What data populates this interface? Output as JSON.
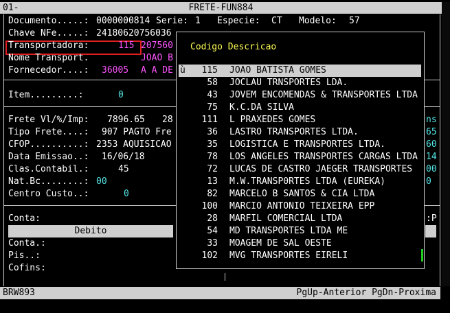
{
  "window": {
    "id": "01-",
    "title": "FRETE-FUN884"
  },
  "header": {
    "documento_label": "Documento.....:",
    "documento_value": "0000000814",
    "serie_label": "Serie:",
    "serie_value": "1",
    "especie_label": "Especie:",
    "especie_value": "CT",
    "modelo_label": "Modelo:",
    "modelo_value": "57"
  },
  "fields": {
    "chave_label": "Chave NFe.....:",
    "chave_value": "24180620756036",
    "transp_label": "Transportadora:",
    "transp_code": "115",
    "transp_extra": "207560",
    "nome_label": "Nome Transport.",
    "nome_value": "JOAO B",
    "fornec_label": "Fornecedor....:",
    "fornec_code": "36005",
    "fornec_name": "A A DE",
    "item_label": "Item.........:",
    "item_value": "0",
    "frete_label": "Frete Vl/%/Imp:",
    "frete_value": "7896.65",
    "frete_pct": "28",
    "tipo_label": "Tipo Frete....:",
    "tipo_value": "907 PAGTO Fre",
    "cfop_label": "CFOP..........:",
    "cfop_value": "2353 AQUISICAO",
    "data_label": "Data Emissao..:",
    "data_value": "16/06/18",
    "clas_label": "Clas.Contabil.:",
    "clas_value": "45",
    "nat_label": "Nat.Bc........:",
    "nat_value": "00",
    "centro_label": "Centro Custo..:",
    "centro_value": "0"
  },
  "right_fragments": [
    "ns",
    "65",
    "60",
    "14",
    "00",
    "0"
  ],
  "right_p": ":P",
  "conta_section": {
    "conta_label": "Conta:",
    "debito_label": "Debito",
    "conta2_label": "Conta.:",
    "pis_label": "Pis..:",
    "cofins_label": "Cofins:"
  },
  "lookup": {
    "header": "Codigo Descricao",
    "selected_marker": "ù",
    "rows": [
      {
        "code": "115",
        "desc": "JOAO BATISTA GOMES"
      },
      {
        "code": "58",
        "desc": "JOCLAU TRNSPORTES LDA."
      },
      {
        "code": "43",
        "desc": "JOVEM ENCOMENDAS & TRANSPORTES LTDA"
      },
      {
        "code": "75",
        "desc": "K.C.DA SILVA"
      },
      {
        "code": "111",
        "desc": "L PRAXEDES GOMES"
      },
      {
        "code": "36",
        "desc": "LASTRO TRANSPORTES LTDA."
      },
      {
        "code": "35",
        "desc": "LOGISTICA E TRANSPORTES LTDA."
      },
      {
        "code": "78",
        "desc": "LOS ANGELES TRANSPORTES CARGAS LTDA"
      },
      {
        "code": "72",
        "desc": "LUCAS DE CASTRO JAEGER TRANSPORTES"
      },
      {
        "code": "13",
        "desc": "M.W.TRANSP0RTES LTDA (EUREKA)"
      },
      {
        "code": "82",
        "desc": "MARCELO B SANTOS & CIA LTDA"
      },
      {
        "code": "100",
        "desc": "MARCIO ANTONIO TEIXEIRA EPP"
      },
      {
        "code": "28",
        "desc": "MARFIL COMERCIAL LTDA"
      },
      {
        "code": "54",
        "desc": "MD TRANSPORTES LTDA ME"
      },
      {
        "code": "33",
        "desc": "MOAGEM DE SAL OESTE"
      },
      {
        "code": "102",
        "desc": "MVG TRANSPORTES EIRELI"
      }
    ]
  },
  "statusbar": {
    "program": "BRW893",
    "hint": "PgUp-Anterior PgDn-Proxima"
  },
  "colors": {
    "background": "#000000",
    "bar": "#cfcfcf",
    "magenta": "#ff55ff",
    "cyan": "#55e6e6",
    "yellow": "#ffff55",
    "highlight_box": "#e02020"
  }
}
